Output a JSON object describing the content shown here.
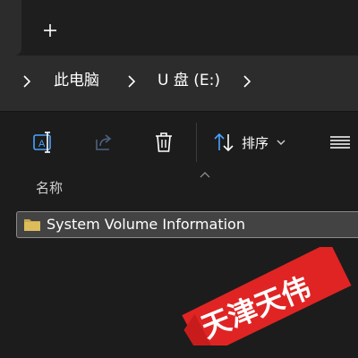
{
  "tabs": {
    "new_tab_label": "+"
  },
  "breadcrumb": {
    "items": [
      {
        "label": "此电脑"
      },
      {
        "label": "U 盘 (E:)"
      }
    ]
  },
  "toolbar": {
    "sort_label": "排序"
  },
  "column_header": {
    "name_label": "名称"
  },
  "files": [
    {
      "name": "System Volume Information",
      "type": "folder"
    }
  ],
  "watermark": {
    "text": "天津天伟"
  },
  "colors": {
    "background": "#1c1c1c",
    "address_bar": "#2c2c2c",
    "selected_row": "#434343",
    "folder": "#c8a84a",
    "watermark_red": "#e02424",
    "accent_blue": "#4aa3ff"
  },
  "icons": {
    "new_tab": "plus-icon",
    "breadcrumb_separator": "chevron-right-icon",
    "rename": "rename-icon",
    "share": "share-icon",
    "delete": "trash-icon",
    "sort": "sort-arrows-icon",
    "sort_dropdown": "chevron-down-icon",
    "view": "view-menu-icon",
    "folder": "folder-icon"
  }
}
